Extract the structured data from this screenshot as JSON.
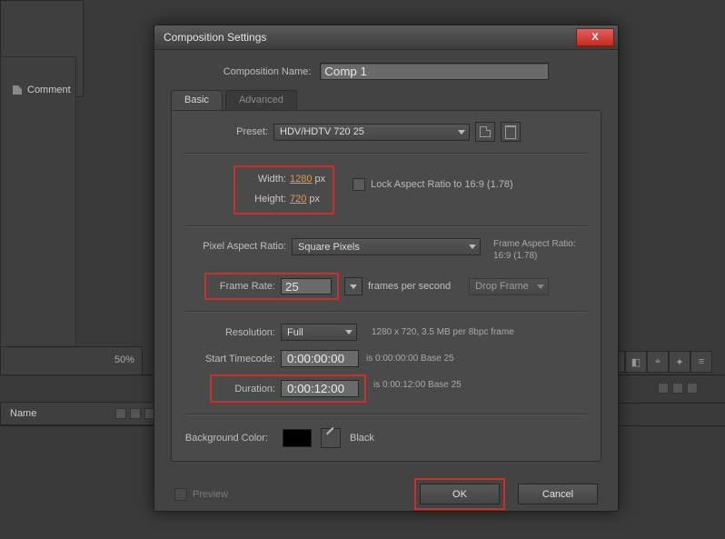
{
  "bg": {
    "comment_label": "Comment",
    "zoom": "50%",
    "name_col": "Name"
  },
  "dialog": {
    "title": "Composition Settings",
    "close": "X",
    "comp_name_label": "Composition Name:",
    "comp_name_value": "Comp 1",
    "tabs": {
      "basic": "Basic",
      "advanced": "Advanced"
    },
    "preset": {
      "label": "Preset:",
      "value": "HDV/HDTV 720 25"
    },
    "dims": {
      "width_label": "Width:",
      "width_value": "1280",
      "height_label": "Height:",
      "height_value": "720",
      "unit": "px",
      "lock_label": "Lock Aspect Ratio to 16:9 (1.78)"
    },
    "par": {
      "label": "Pixel Aspect Ratio:",
      "value": "Square Pixels",
      "info_l1": "Frame Aspect Ratio:",
      "info_l2": "16:9 (1.78)"
    },
    "frate": {
      "label": "Frame Rate:",
      "value": "25",
      "suffix": "frames per second",
      "drop": "Drop Frame"
    },
    "res": {
      "label": "Resolution:",
      "value": "Full",
      "info": "1280 x 720, 3.5 MB per 8bpc frame"
    },
    "start_tc": {
      "label": "Start Timecode:",
      "value": "0:00:00:00",
      "info": "is 0:00:00:00  Base 25"
    },
    "duration": {
      "label": "Duration:",
      "value": "0:00:12:00",
      "info": "is 0:00:12:00  Base 25"
    },
    "bgc": {
      "label": "Background Color:",
      "name": "Black",
      "hex": "#000000"
    },
    "footer": {
      "preview": "Preview",
      "ok": "OK",
      "cancel": "Cancel"
    }
  }
}
